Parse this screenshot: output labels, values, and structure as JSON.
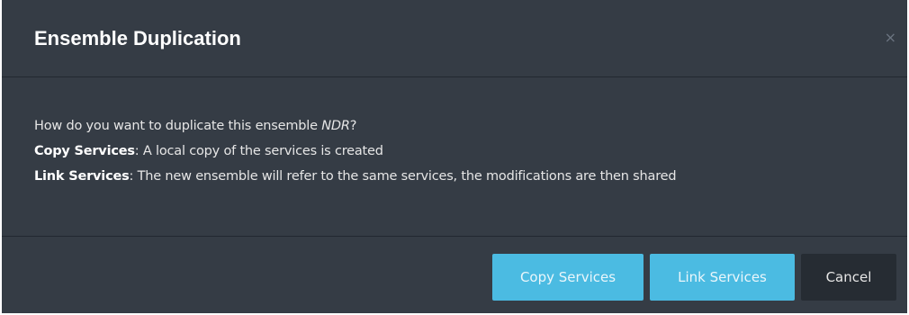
{
  "dialog": {
    "title": "Ensemble Duplication",
    "close_glyph": "×",
    "question_prefix": "How do you want to duplicate this ensemble ",
    "ensemble_name": "NDR",
    "question_suffix": "?",
    "copy_term": "Copy Services",
    "copy_desc": ": A local copy of the services is created",
    "link_term": "Link Services",
    "link_desc": ": The new ensemble will refer to the same services, the modifications are then shared"
  },
  "buttons": {
    "copy_label": "Copy Services",
    "link_label": "Link Services",
    "cancel_label": "Cancel"
  },
  "colors": {
    "background": "#353c45",
    "primary": "#4bbbe2",
    "cancel": "#262c33"
  },
  "icons": {
    "close": "close-icon"
  }
}
